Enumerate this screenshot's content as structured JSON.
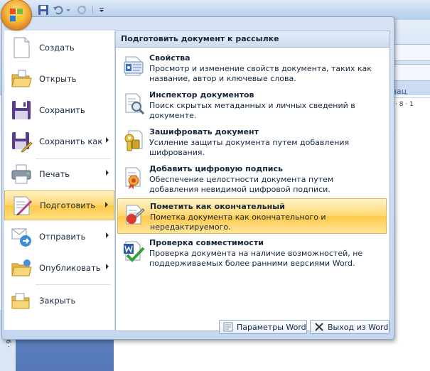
{
  "background": {
    "paragraph_label": "зац",
    "ruler_text": "· 8 · 1",
    "vruler_text": "· 6 ·"
  },
  "menu": {
    "left_items": [
      {
        "label": "Создать",
        "icon": "new-document-icon",
        "has_submenu": false
      },
      {
        "label": "Открыть",
        "icon": "open-folder-icon",
        "has_submenu": false
      },
      {
        "label": "Сохранить",
        "icon": "save-floppy-icon",
        "has_submenu": false
      },
      {
        "label": "Сохранить как",
        "icon": "save-as-icon",
        "has_submenu": true
      },
      {
        "label": "Печать",
        "icon": "printer-icon",
        "has_submenu": true
      },
      {
        "label": "Подготовить",
        "icon": "prepare-document-icon",
        "has_submenu": true,
        "active": true
      },
      {
        "label": "Отправить",
        "icon": "send-icon",
        "has_submenu": true
      },
      {
        "label": "Опубликовать",
        "icon": "publish-icon",
        "has_submenu": true
      },
      {
        "label": "Закрыть",
        "icon": "close-folder-icon",
        "has_submenu": false
      }
    ],
    "submenu": {
      "header": "Подготовить документ к рассылке",
      "items": [
        {
          "title": "Свойства",
          "desc": "Просмотр и изменение свойств документа, таких как название, автор и ключевые слова.",
          "icon": "properties-icon"
        },
        {
          "title": "Инспектор документов",
          "desc": "Поиск скрытых метаданных и личных сведений в документе.",
          "icon": "inspect-document-icon"
        },
        {
          "title": "Зашифровать документ",
          "desc": "Усиление защиты документа путем добавления шифрования.",
          "icon": "encrypt-keys-icon"
        },
        {
          "title": "Добавить цифровую подпись",
          "desc": "Обеспечение целостности документа путем добавления невидимой цифровой подписи.",
          "icon": "digital-signature-icon"
        },
        {
          "title": "Пометить как окончательный",
          "desc": "Пометка документа как окончательного и нередактируемого.",
          "icon": "mark-final-icon",
          "active": true
        },
        {
          "title": "Проверка совместимости",
          "desc": "Проверка документа на наличие возможностей, не поддерживаемых более ранними версиями Word.",
          "icon": "compatibility-check-icon"
        }
      ]
    },
    "bottom_buttons": {
      "options": "Параметры Word",
      "exit": "Выход из Word"
    }
  },
  "colors": {
    "active_highlight": "#ffd56f",
    "menu_frame": "#c5d7ef",
    "office_button": "#f7b33a"
  }
}
